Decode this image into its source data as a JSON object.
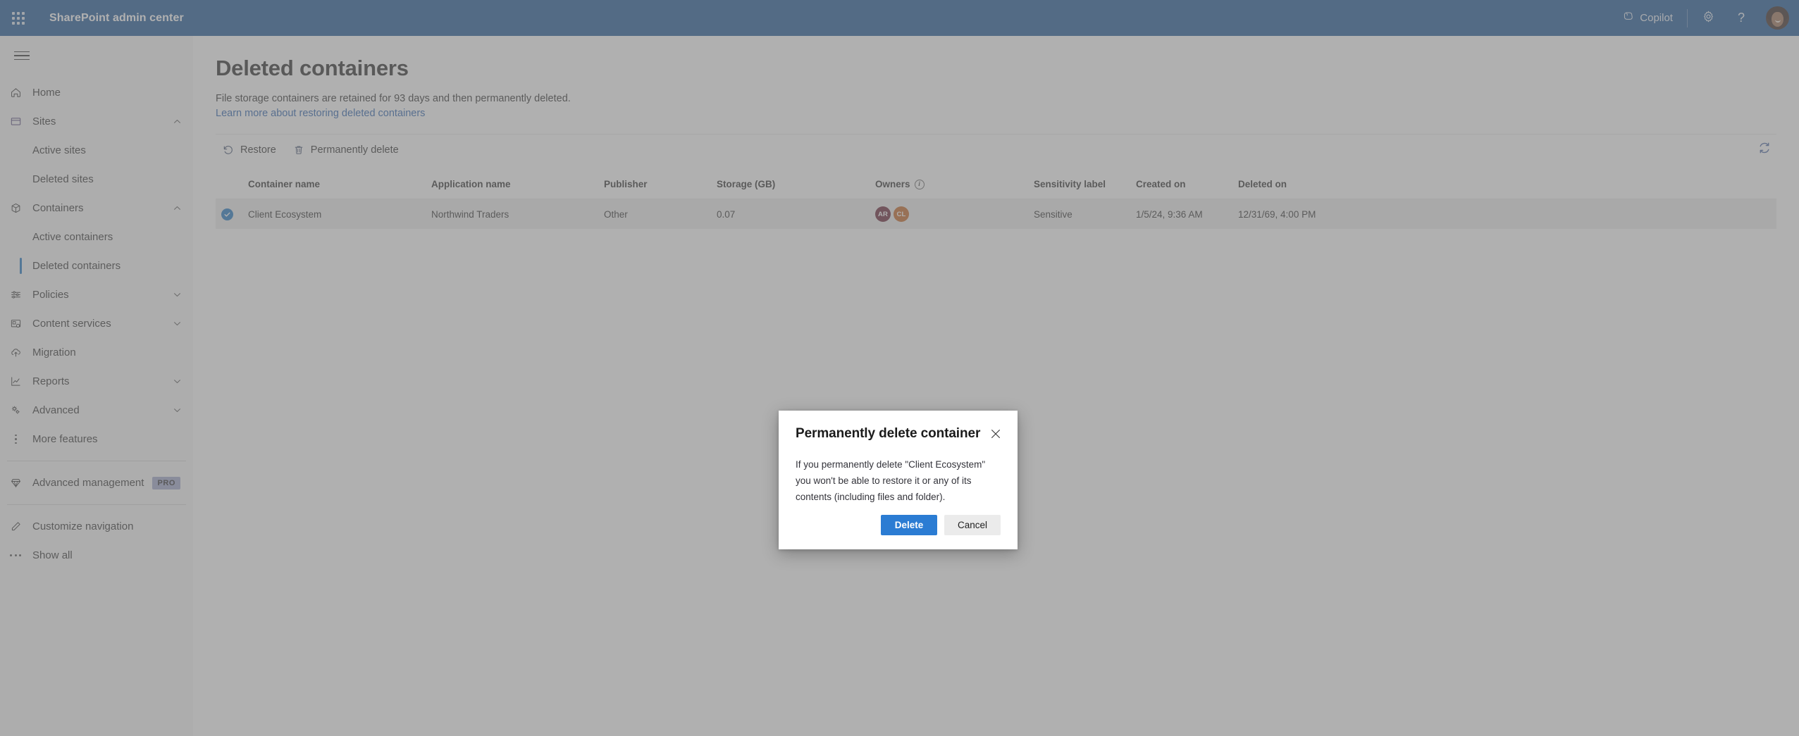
{
  "suite": {
    "waffle_label": "app-launcher",
    "title": "SharePoint admin center",
    "copilot_label": "Copilot",
    "settings_label": "Settings",
    "help_label": "?",
    "account_label": "Account manager"
  },
  "sidebar": {
    "hamburger_label": "Global navigation",
    "items": [
      {
        "label": "Home",
        "icon": "home-icon",
        "level": "top",
        "expandable": false
      },
      {
        "label": "Sites",
        "icon": "sites-icon",
        "level": "top",
        "expandable": true,
        "chevron": "up"
      },
      {
        "label": "Active sites",
        "icon": "",
        "level": "sub",
        "expandable": false
      },
      {
        "label": "Deleted sites",
        "icon": "",
        "level": "sub",
        "expandable": false
      },
      {
        "label": "Containers",
        "icon": "box-icon",
        "level": "top",
        "expandable": true,
        "chevron": "up"
      },
      {
        "label": "Active containers",
        "icon": "",
        "level": "sub",
        "expandable": false
      },
      {
        "label": "Deleted containers",
        "icon": "",
        "level": "sub",
        "expandable": false,
        "selected": true
      },
      {
        "label": "Policies",
        "icon": "sliders-icon",
        "level": "top",
        "expandable": true,
        "chevron": "down"
      },
      {
        "label": "Content services",
        "icon": "content-services-icon",
        "level": "top",
        "expandable": true,
        "chevron": "down"
      },
      {
        "label": "Migration",
        "icon": "migration-cloud-icon",
        "level": "top",
        "expandable": false
      },
      {
        "label": "Reports",
        "icon": "reports-chart-icon",
        "level": "top",
        "expandable": true,
        "chevron": "down"
      },
      {
        "label": "Advanced",
        "icon": "advanced-gears-icon",
        "level": "top",
        "expandable": true,
        "chevron": "down"
      },
      {
        "label": "More features",
        "icon": "more-features-icon",
        "level": "top",
        "expandable": false
      }
    ],
    "advanced_management": {
      "label": "Advanced management",
      "badge": "PRO",
      "icon": "diamond-icon"
    },
    "customize_navigation": {
      "label": "Customize navigation",
      "icon": "pencil-icon"
    },
    "show_all": {
      "label": "Show all",
      "icon": "ellipsis-icon"
    }
  },
  "page": {
    "title": "Deleted containers",
    "description": "File storage containers are retained for 93 days and then permanently deleted.",
    "link": "Learn more about restoring deleted containers"
  },
  "commandbar": {
    "restore_label": "Restore",
    "delete_label": "Permanently delete",
    "refresh_label": "Refresh"
  },
  "table": {
    "columns": [
      "Container name",
      "Application name",
      "Publisher",
      "Storage (GB)",
      "Owners",
      "Sensitivity label",
      "Created on",
      "Deleted on"
    ],
    "owners_info_tooltip": "i",
    "rows": [
      {
        "selected": true,
        "container_name": "Client Ecosystem",
        "application_name": "Northwind Traders",
        "publisher": "Other",
        "storage_gb": "0.07",
        "owners": [
          {
            "initials": "AR",
            "color": "#5c1225"
          },
          {
            "initials": "CL",
            "color": "#bf5a14"
          }
        ],
        "sensitivity_label": "Sensitive",
        "created_on": "1/5/24, 9:36 AM",
        "deleted_on": "12/31/69, 4:00 PM"
      }
    ]
  },
  "dialog": {
    "title": "Permanently delete container",
    "close_label": "Close",
    "body": "If you permanently delete \"Client Ecosystem\" you won't be able to restore it or any of its contents (including files and folder).",
    "primary_button": "Delete",
    "secondary_button": "Cancel"
  },
  "colors": {
    "suitebar": "#0b4a8f",
    "accent": "#0f6cbd",
    "primary_button": "#2b7cd3",
    "link": "#1a55a8",
    "selected_row": "#ededed"
  }
}
